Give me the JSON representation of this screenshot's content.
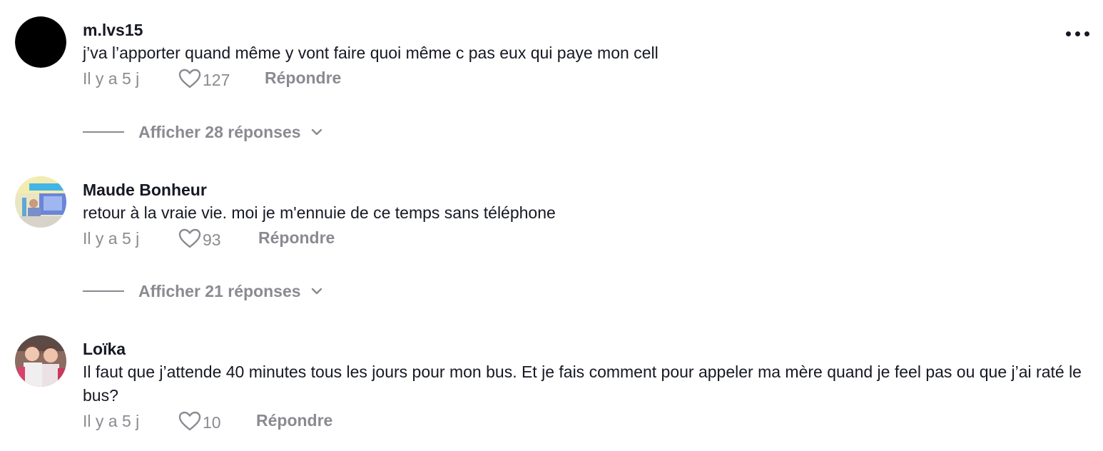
{
  "comments": [
    {
      "username": "m.lvs15",
      "text": "j’va l’apporter quand même y vont faire quoi même c pas eux qui paye mon cell",
      "time": "Il y a 5 j",
      "likes": "127",
      "reply_label": "Répondre",
      "show_replies": "Afficher 28 réponses",
      "avatar_color": "#000000"
    },
    {
      "username": "Maude Bonheur",
      "text": "retour à la vraie vie. moi je m'ennuie de ce temps sans téléphone",
      "time": "Il y a 5 j",
      "likes": "93",
      "reply_label": "Répondre",
      "show_replies": "Afficher 21 réponses"
    },
    {
      "username": "Loïka",
      "text": "Il faut que j’attende 40 minutes tous les jours pour mon bus. Et je fais comment pour appeler ma mère quand je feel pas ou que j’ai raté le bus?",
      "time": "Il y a 5 j",
      "likes": "10",
      "reply_label": "Répondre"
    }
  ],
  "colors": {
    "text": "#161823",
    "secondary": "#8a8b91",
    "background": "#ffffff"
  },
  "icons": {
    "more": "more-horizontal-icon",
    "like": "heart-outline-icon",
    "expand": "chevron-down-icon"
  }
}
